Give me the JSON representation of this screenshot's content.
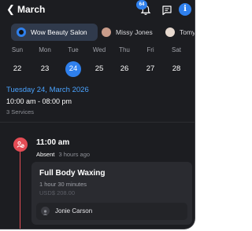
{
  "header": {
    "back_icon": "chevron-left-icon",
    "title": "March",
    "notification_count": "64",
    "bell_icon": "bell-icon",
    "chat_icon": "message-icon",
    "info_label": "i",
    "accent_color": "#2f80ed"
  },
  "staff_chips": [
    {
      "label": "Wow Beauty Salon",
      "active": true
    },
    {
      "label": "Missy Jones",
      "active": false
    },
    {
      "label": "Tomy",
      "active": false
    }
  ],
  "week": {
    "days": [
      {
        "name": "Sun",
        "num": "22"
      },
      {
        "name": "Mon",
        "num": "23"
      },
      {
        "name": "Tue",
        "num": "24",
        "selected": true
      },
      {
        "name": "Wed",
        "num": "25"
      },
      {
        "name": "Thu",
        "num": "26"
      },
      {
        "name": "Fri",
        "num": "27"
      },
      {
        "name": "Sat",
        "num": "28"
      }
    ]
  },
  "selected_day": {
    "title": "Tuesday 24, March 2026",
    "hours": "10:00 am - 08:00 pm",
    "services": "3 Services"
  },
  "appointment": {
    "time": "11:00 am",
    "status": "Absent",
    "ago": "3 hours ago",
    "status_color": "#e54c55",
    "service_name": "Full Body Waxing",
    "duration": "1 hour 30 minutes",
    "price": "USD$ 208.00",
    "staff_name": "Jonie Carson"
  }
}
